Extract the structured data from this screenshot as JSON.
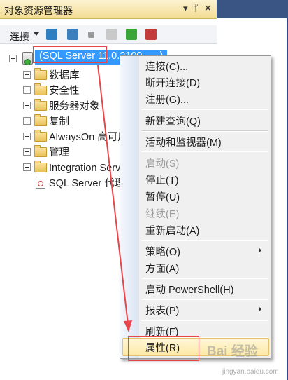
{
  "window": {
    "title": "对象资源管理器",
    "title_buttons": [
      "▾",
      "ᛘ",
      "✕"
    ]
  },
  "toolbar": {
    "connect_label": "连接",
    "tools": [
      {
        "name": "connect-object-explorer-icon",
        "color": "#2e7fc1"
      },
      {
        "name": "disconnect-icon",
        "color": "#3c7fbd"
      },
      {
        "name": "stop-icon",
        "color": "#9a9a9a"
      },
      {
        "name": "filter-icon",
        "color": "#a9a9a9"
      },
      {
        "name": "refresh-icon",
        "color": "#3aa63a"
      },
      {
        "name": "activity-monitor-icon",
        "color": "#c43b3b"
      }
    ]
  },
  "tree": {
    "root_label": "(SQL Server 11.0.2100 - ...)",
    "items": [
      {
        "label": "数据库"
      },
      {
        "label": "安全性"
      },
      {
        "label": "服务器对象"
      },
      {
        "label": "复制"
      },
      {
        "label": "AlwaysOn 高可用性"
      },
      {
        "label": "管理"
      },
      {
        "label": "Integration Services 目录"
      },
      {
        "label": "SQL Server 代理(已禁用代理 XP)"
      }
    ]
  },
  "context_menu": {
    "items": [
      {
        "label": "连接(C)...",
        "enabled": true
      },
      {
        "label": "断开连接(D)",
        "enabled": true
      },
      {
        "label": "注册(G)...",
        "enabled": true
      },
      {
        "label": "新建查询(Q)",
        "enabled": true
      },
      {
        "label": "活动和监视器(M)",
        "enabled": true
      },
      {
        "label": "启动(S)",
        "enabled": false
      },
      {
        "label": "停止(T)",
        "enabled": true
      },
      {
        "label": "暂停(U)",
        "enabled": true
      },
      {
        "label": "继续(E)",
        "enabled": false
      },
      {
        "label": "重新启动(A)",
        "enabled": true
      },
      {
        "label": "策略(O)",
        "enabled": true,
        "submenu": true
      },
      {
        "label": "方面(A)",
        "enabled": true
      },
      {
        "label": "启动 PowerShell(H)",
        "enabled": true
      },
      {
        "label": "报表(P)",
        "enabled": true,
        "submenu": true
      },
      {
        "label": "刷新(F)",
        "enabled": true
      },
      {
        "label": "属性(R)",
        "enabled": true,
        "highlighted": true
      }
    ]
  },
  "watermark": {
    "text": "Bai 经验",
    "url": "jingyan.baidu.com"
  },
  "colors": {
    "selection": "#3399ff",
    "annotation": "#e6454a",
    "frame": "#3a5483"
  }
}
